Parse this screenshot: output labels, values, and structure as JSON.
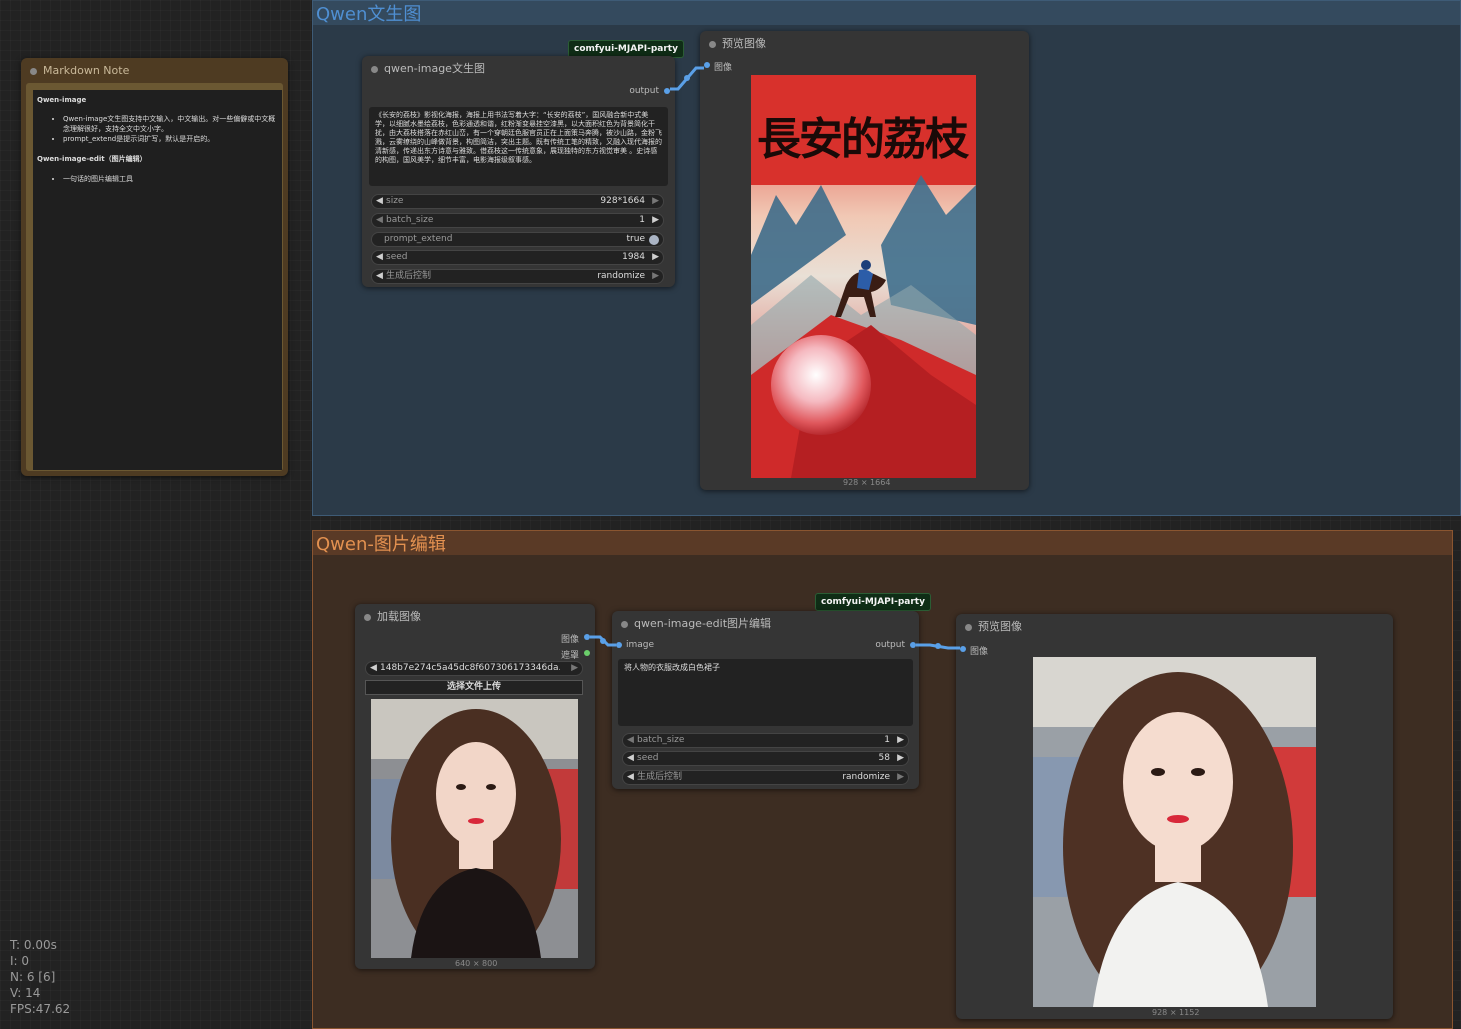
{
  "groups": {
    "top": {
      "title": "Qwen文生图"
    },
    "bottom": {
      "title": "Qwen-图片编辑"
    }
  },
  "note": {
    "title": "Markdown Note",
    "sections": [
      {
        "heading": "Qwen-image",
        "items": [
          "Qwen-image文生图支持中文输入，中文输出。对一些偏僻或中文概念理解很好，支持全文中文小字。",
          "prompt_extend是提示词扩写，默认是开启的。"
        ]
      },
      {
        "heading": "Qwen-image-edit（图片编辑）",
        "items": [
          "一句话的图片编辑工具"
        ]
      }
    ]
  },
  "t2i_node": {
    "badge": "comfyui-MJAPI-party",
    "title": "qwen-image文生图",
    "output_label": "output",
    "prompt": "《长安的荔枝》影视化海报，海报上用书法写着大字：“长安的荔枝”，国风融合新中式美学，以细腻水墨绘荔枝，色彩通透和谐，红粉渐变悬挂空漆黑，以大面积红色为背景简化干扰，由大荔枝搭落在赤红山峦，有一个穿朝廷色服官员正在上面策马奔腾，被沙山路，金粉飞溅，云雾缭绕的山峰做背景，构图简洁，突出主题。既有传统工笔的精致，又融入现代海报的清新感，传递出东方诗意与雅致。借荔枝这一传统意象，展现独特的东方视觉审美 。史诗感的构图，国风美学，细节丰富，电影海报级叙事感。",
    "widgets": [
      {
        "label": "size",
        "value": "928*1664"
      },
      {
        "label": "batch_size",
        "value": "1"
      },
      {
        "label": "prompt_extend",
        "value": "true"
      },
      {
        "label": "seed",
        "value": "1984"
      },
      {
        "label": "生成后控制",
        "value": "randomize"
      }
    ]
  },
  "preview_top": {
    "title": "预览图像",
    "input_label": "图像",
    "image_title_text": "長安的荔枝",
    "caption": "928 × 1664"
  },
  "load_node": {
    "title": "加载图像",
    "out_image": "图像",
    "out_mask": "遮罩",
    "file": "148b7e274c5a45dc8f607306173346da.j...",
    "upload_label": "选择文件上传",
    "caption": "640 × 800"
  },
  "edit_node": {
    "badge": "comfyui-MJAPI-party",
    "title": "qwen-image-edit图片编辑",
    "input_label": "image",
    "output_label": "output",
    "prompt": "将人物的衣服改成白色裙子",
    "widgets": [
      {
        "label": "batch_size",
        "value": "1"
      },
      {
        "label": "seed",
        "value": "58"
      },
      {
        "label": "生成后控制",
        "value": "randomize"
      }
    ]
  },
  "preview_bottom": {
    "title": "预览图像",
    "input_label": "图像",
    "caption": "928 × 1152"
  },
  "stats": {
    "t": "T: 0.00s",
    "i": "I: 0",
    "n": "N: 6 [6]",
    "v": "V: 14",
    "fps": "FPS:47.62"
  },
  "colors": {
    "link": "#5aa0e8",
    "group_top": "#2b3a48",
    "group_bottom": "#3d2d22",
    "node": "#353535",
    "badge": "#0f2d16"
  }
}
